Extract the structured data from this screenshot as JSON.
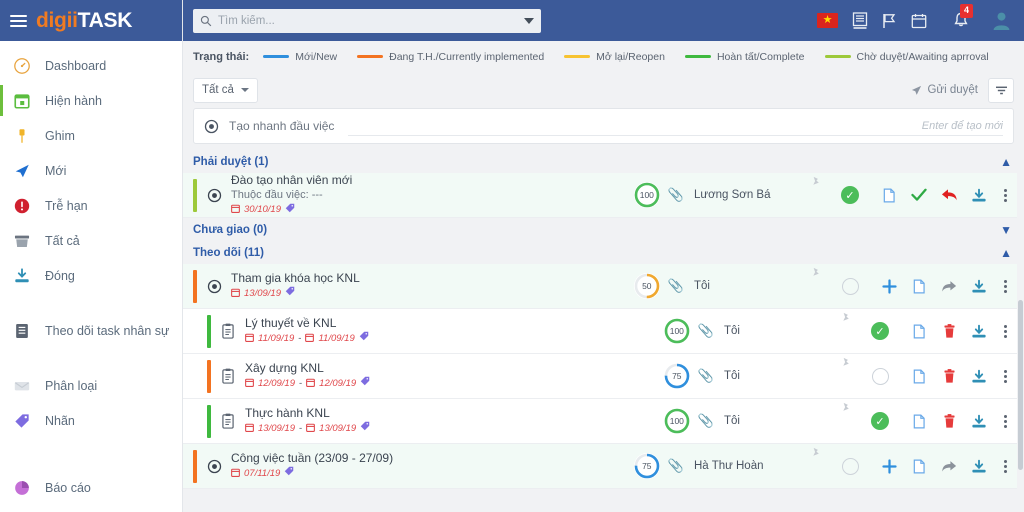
{
  "brand": {
    "part1": "digii",
    "part2": "TASK"
  },
  "sidebar": {
    "items": [
      {
        "label": "Dashboard",
        "icon": "gauge-icon"
      },
      {
        "label": "Hiện hành",
        "icon": "calendar-icon",
        "active": true
      },
      {
        "label": "Ghim",
        "icon": "pin-icon"
      },
      {
        "label": "Mới",
        "icon": "send-icon"
      },
      {
        "label": "Trễ hạn",
        "icon": "alert-icon"
      },
      {
        "label": "Tất cả",
        "icon": "archive-icon"
      },
      {
        "label": "Đóng",
        "icon": "download-icon"
      },
      {
        "label": "Theo dõi task nhân sự",
        "icon": "list-icon"
      },
      {
        "label": "Phân loại",
        "icon": "envelope-icon"
      },
      {
        "label": "Nhãn",
        "icon": "tag-icon"
      },
      {
        "label": "Báo cáo",
        "icon": "pie-icon"
      }
    ]
  },
  "topbar": {
    "search_placeholder": "Tìm kiếm...",
    "search_value": "",
    "flag_label": "★",
    "notification_count": "4"
  },
  "legend": {
    "title": "Trạng thái:",
    "items": [
      {
        "label": "Mới/New",
        "color": "#2f8fdd"
      },
      {
        "label": "Đang T.H./Currently implemented",
        "color": "#f37321"
      },
      {
        "label": "Mở lại/Reopen",
        "color": "#f7c331"
      },
      {
        "label": "Hoàn tất/Complete",
        "color": "#3fb93f"
      },
      {
        "label": "Chờ duyệt/Awaiting aprroval",
        "color": "#9dc93a"
      }
    ]
  },
  "toolbar": {
    "filter_select": "Tất cả",
    "send_approval": "Gửi duyệt"
  },
  "quick_create": {
    "label": "Tạo nhanh đầu việc",
    "placeholder": "Enter để tạo mới",
    "value": ""
  },
  "sections": [
    {
      "title": "Phải duyệt (1)",
      "expanded": true,
      "chevron": "▲",
      "rows": [
        {
          "title": "Đào tạo nhân viên mới",
          "subtitle": "Thuộc đầu việc: ---",
          "date": "30/10/19",
          "date2": "",
          "progress": "100",
          "progress_color": "#4cbd5a",
          "bar_color": "#9dc93a",
          "assignee": "Lương Sơn Bá",
          "status": "done",
          "type": "parent",
          "tint": true,
          "actions": [
            "doc-icon",
            "check-icon",
            "reply-icon",
            "download-icon",
            "more-icon"
          ]
        }
      ]
    },
    {
      "title": "Chưa giao (0)",
      "expanded": false,
      "chevron": "▼",
      "rows": []
    },
    {
      "title": "Theo dõi (11)",
      "expanded": true,
      "chevron": "▲",
      "rows": [
        {
          "title": "Tham gia khóa học KNL",
          "subtitle": "",
          "date": "13/09/19",
          "date2": "",
          "progress": "50",
          "progress_color": "#f0a82e",
          "bar_color": "#f37321",
          "assignee": "Tôi",
          "status": "empty",
          "type": "parent",
          "tint": true,
          "actions": [
            "plus-icon",
            "doc-icon",
            "forward-icon",
            "download-icon",
            "more-icon"
          ]
        },
        {
          "title": "Lý thuyết về KNL",
          "subtitle": "",
          "date": "11/09/19",
          "date2": "11/09/19",
          "progress": "100",
          "progress_color": "#4cbd5a",
          "bar_color": "#3fb93f",
          "assignee": "Tôi",
          "status": "done",
          "type": "sub",
          "tint": false,
          "actions": [
            "doc-icon",
            "trash-icon",
            "download-icon",
            "more-icon"
          ]
        },
        {
          "title": "Xây dựng KNL",
          "subtitle": "",
          "date": "12/09/19",
          "date2": "12/09/19",
          "progress": "75",
          "progress_color": "#2f8fdd",
          "bar_color": "#f37321",
          "assignee": "Tôi",
          "status": "empty",
          "type": "sub",
          "tint": false,
          "actions": [
            "doc-icon",
            "trash-icon",
            "download-icon",
            "more-icon"
          ]
        },
        {
          "title": "Thực hành KNL",
          "subtitle": "",
          "date": "13/09/19",
          "date2": "13/09/19",
          "progress": "100",
          "progress_color": "#4cbd5a",
          "bar_color": "#3fb93f",
          "assignee": "Tôi",
          "status": "done",
          "type": "sub",
          "tint": false,
          "actions": [
            "doc-icon",
            "trash-icon",
            "download-icon",
            "more-icon"
          ]
        },
        {
          "title": "Công việc tuần (23/09 - 27/09)",
          "subtitle": "",
          "date": "07/11/19",
          "date2": "",
          "progress": "75",
          "progress_color": "#2f8fdd",
          "bar_color": "#f37321",
          "assignee": "Hà Thư Hoàn",
          "status": "empty",
          "type": "parent",
          "tint": true,
          "actions": [
            "plus-icon",
            "doc-icon",
            "forward-icon",
            "download-icon",
            "more-icon"
          ]
        }
      ]
    }
  ]
}
